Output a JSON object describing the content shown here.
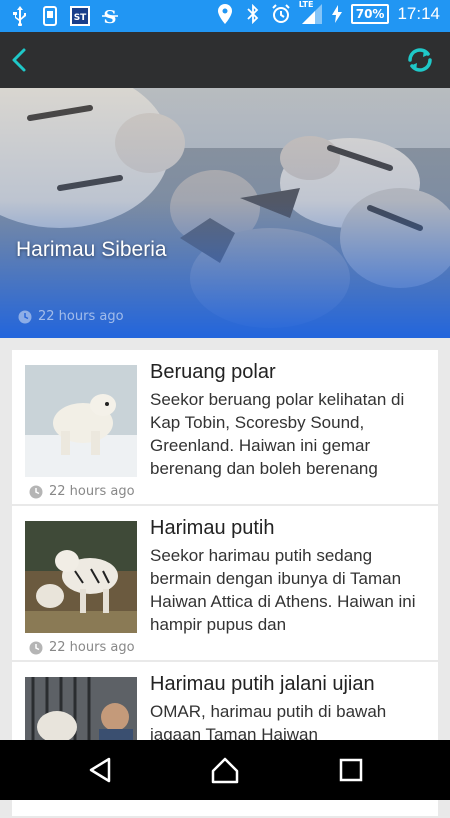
{
  "status_bar": {
    "left_icons": [
      "usb-icon",
      "sd-card-icon",
      "st-app-icon",
      "s-app-icon"
    ],
    "lte_label": "LTE",
    "battery_percent": "70%",
    "time": "17:14"
  },
  "app_bar": {
    "back_icon": "back-chevron-icon",
    "refresh_icon": "refresh-icon"
  },
  "featured": {
    "title": "Harimau Siberia",
    "time": "22 hours ago"
  },
  "articles": [
    {
      "title": "Beruang polar",
      "snippet": "Seekor beruang polar kelihatan di Kap Tobin, Scoresby Sound, Greenland. Haiwan ini gemar berenang dan boleh berenang",
      "time": "22 hours ago"
    },
    {
      "title": "Harimau putih",
      "snippet": "Seekor harimau putih sedang bermain dengan ibunya di Taman Haiwan Attica di Athens. Haiwan ini hampir pupus dan",
      "time": "22 hours ago"
    },
    {
      "title": "Harimau putih jalani ujian",
      "snippet": "OMAR, harimau putih di bawah jagaan Taman Haiwan",
      "time": ""
    }
  ],
  "colors": {
    "status_bar": "#2196f3",
    "app_bar": "#2e2f30",
    "accent": "#1fc8c8"
  }
}
